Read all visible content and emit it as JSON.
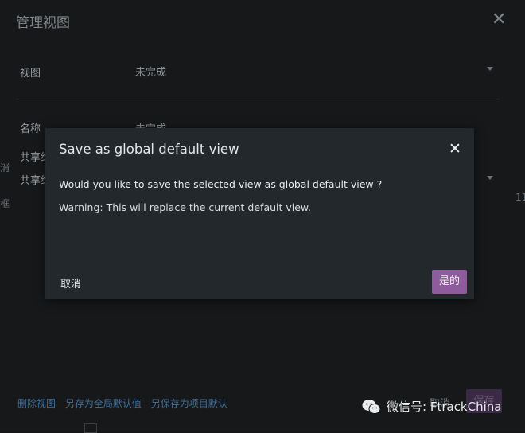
{
  "background": {
    "title": "管理视图",
    "rows": [
      {
        "label": "视图",
        "value": "未完成"
      },
      {
        "label": "名称",
        "value": "未完成"
      },
      {
        "label": "共享给",
        "value": ""
      },
      {
        "label": "共享给",
        "value": ""
      }
    ],
    "edge_text_left_1": "消",
    "edge_text_left_2": "框",
    "edge_text_right": "11",
    "footer_links": [
      "删除视图",
      "另存为全局默认值",
      "另保存为项目默认"
    ],
    "cancel_label": "取消",
    "save_label": "保存"
  },
  "dialog": {
    "title": "Save as global default view",
    "question": "Would you like to save the selected view as global default view ?",
    "warning": "Warning: This will replace the current default view.",
    "cancel_label": "取消",
    "confirm_label": "是的"
  },
  "watermark": {
    "text": "微信号: FtrackChina"
  },
  "colors": {
    "dialog_bg": "#23282d",
    "confirm_button": "#8e5b9c",
    "link": "#3f6f9d"
  }
}
